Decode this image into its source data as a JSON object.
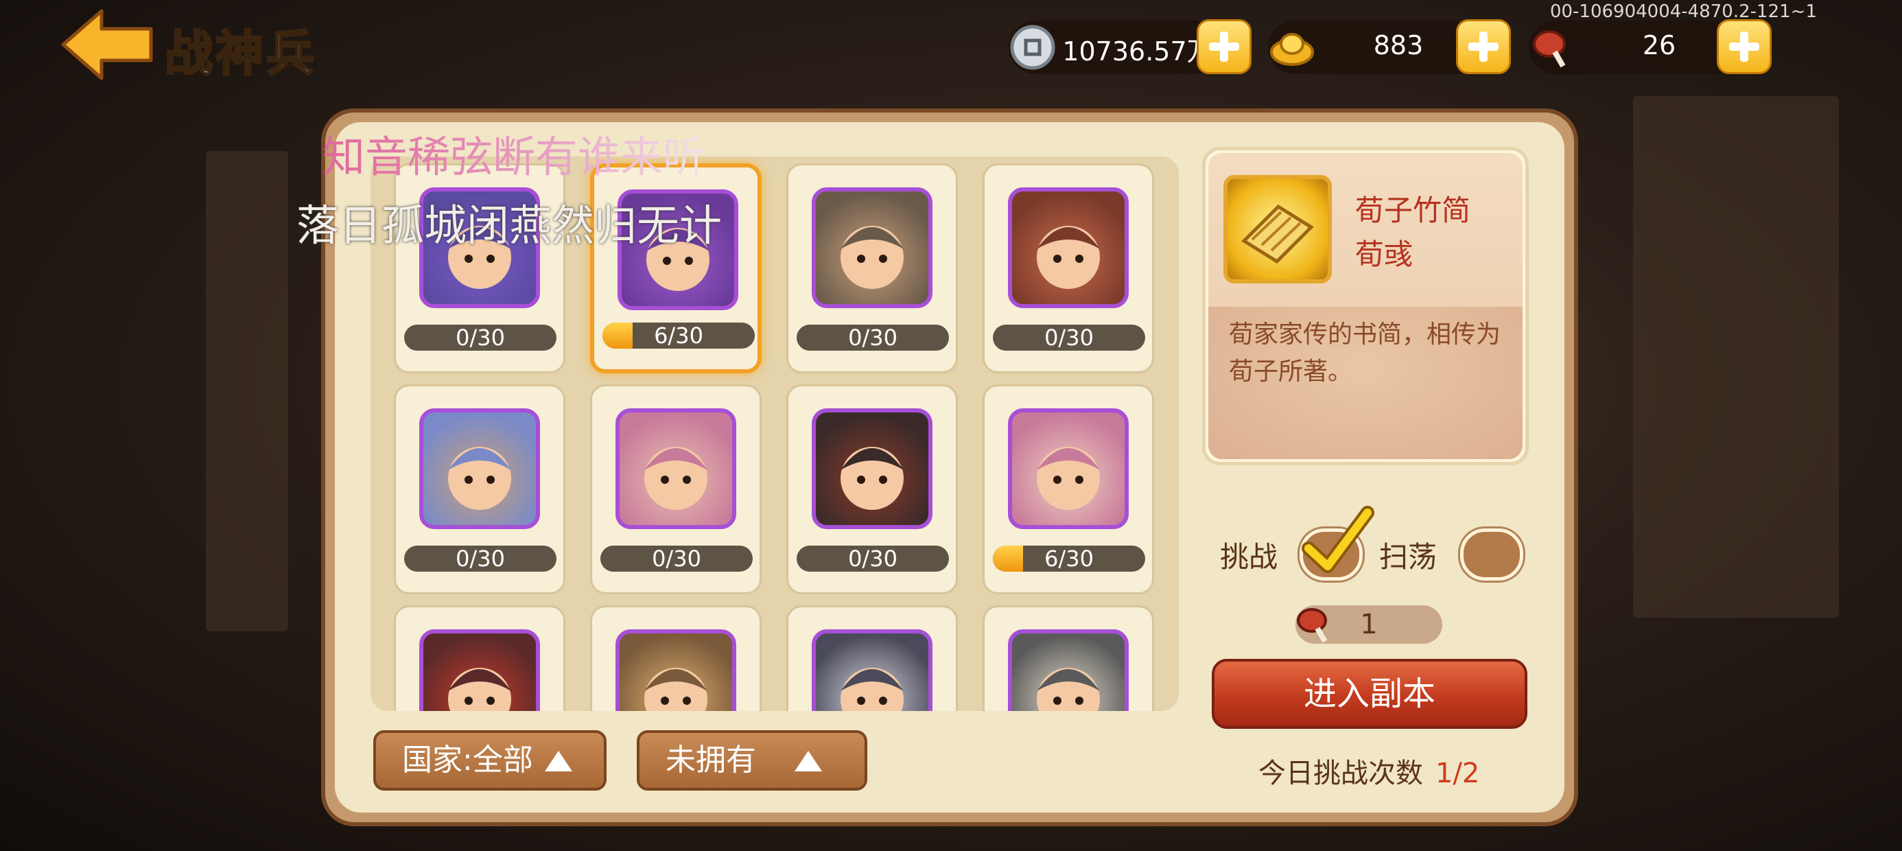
{
  "header": {
    "title": "战神兵",
    "build_id": "00-106904004-4870.2-121~1"
  },
  "resources": [
    {
      "name": "silver",
      "icon": "coin-icon",
      "value": "10736.57万"
    },
    {
      "name": "gold",
      "icon": "gold-ingot-icon",
      "value": "883"
    },
    {
      "name": "stamina",
      "icon": "meat-icon",
      "value": "26"
    }
  ],
  "heroes": [
    {
      "progress_label": "0/30",
      "progress": 0.0,
      "selected": false
    },
    {
      "progress_label": "6/30",
      "progress": 0.2,
      "selected": true
    },
    {
      "progress_label": "0/30",
      "progress": 0.0,
      "selected": false
    },
    {
      "progress_label": "0/30",
      "progress": 0.0,
      "selected": false
    },
    {
      "progress_label": "0/30",
      "progress": 0.0,
      "selected": false
    },
    {
      "progress_label": "0/30",
      "progress": 0.0,
      "selected": false
    },
    {
      "progress_label": "0/30",
      "progress": 0.0,
      "selected": false
    },
    {
      "progress_label": "6/30",
      "progress": 0.2,
      "selected": false
    },
    {
      "progress_label": "",
      "progress": 0.0,
      "selected": false
    },
    {
      "progress_label": "",
      "progress": 0.0,
      "selected": false
    },
    {
      "progress_label": "",
      "progress": 0.0,
      "selected": false
    },
    {
      "progress_label": "",
      "progress": 0.0,
      "selected": false
    }
  ],
  "item": {
    "name": "荀子竹简",
    "owner": "荀彧",
    "description": "荀家家传的书简，相传为荀子所著。"
  },
  "controls": {
    "challenge_label": "挑战",
    "sweep_label": "扫荡",
    "challenge_checked": true,
    "sweep_checked": false,
    "cost": "1",
    "enter_label": "进入副本",
    "today_label": "今日挑战次数",
    "today_value": "1/2"
  },
  "filters": {
    "country": "国家:全部",
    "ownership": "未拥有"
  },
  "watermark": {
    "line1": "知音稀弦断有谁来听",
    "line2": "落日孤城闭燕然归无计"
  }
}
